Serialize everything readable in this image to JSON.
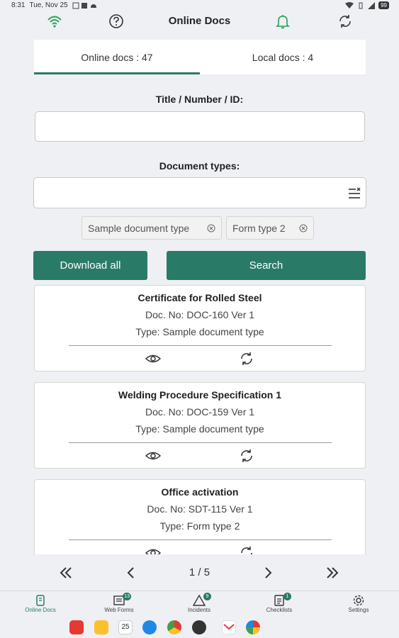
{
  "status_bar": {
    "time": "8:31",
    "date": "Tue, Nov 25",
    "battery": "99"
  },
  "app_bar": {
    "title": "Online Docs"
  },
  "tabs": [
    {
      "label": "Online docs : 47",
      "active": true
    },
    {
      "label": "Local docs : 4",
      "active": false
    }
  ],
  "search": {
    "title_label": "Title / Number / ID:",
    "title_value": "",
    "types_label": "Document types:",
    "types_value": ""
  },
  "chips": [
    "Sample document type",
    "Form type 2"
  ],
  "buttons": {
    "download_all": "Download all",
    "search": "Search"
  },
  "documents": [
    {
      "title": "Certificate for Rolled Steel",
      "doc_no": "Doc. No: DOC-160   Ver 1",
      "type": "Type: Sample document type"
    },
    {
      "title": "Welding Procedure Specification 1",
      "doc_no": "Doc. No: DOC-159   Ver 1",
      "type": "Type: Sample document type"
    },
    {
      "title": "Office activation",
      "doc_no": "Doc. No: SDT-115   Ver 1",
      "type": "Type: Form type 2"
    }
  ],
  "pager": {
    "page": "1 / 5"
  },
  "bottom_nav": [
    {
      "label": "Online Docs",
      "icon": "docs-icon",
      "active": true,
      "badge": ""
    },
    {
      "label": "Web Forms",
      "icon": "web-forms-icon",
      "active": false,
      "badge": "13"
    },
    {
      "label": "Incidents",
      "icon": "warning-icon",
      "active": false,
      "badge": "9"
    },
    {
      "label": "Checklists",
      "icon": "checklist-icon",
      "active": false,
      "badge": "1"
    },
    {
      "label": "Settings",
      "icon": "gear-icon",
      "active": false,
      "badge": ""
    }
  ],
  "taskbar": {
    "calendar_day": "25"
  },
  "colors": {
    "accent": "#2a7a68",
    "background": "#eef0f3"
  }
}
